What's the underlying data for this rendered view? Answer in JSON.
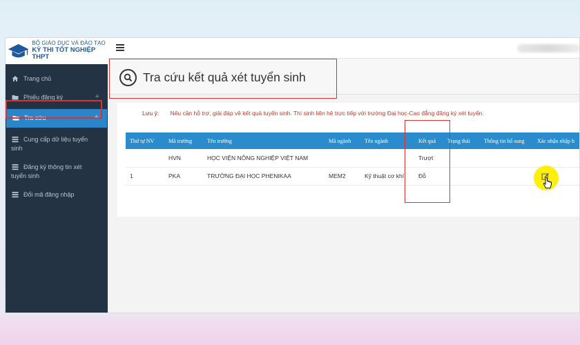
{
  "logo": {
    "line1": "BỘ GIÁO DỤC VÀ ĐÀO TẠO",
    "line2": "KỲ THI TỐT NGHIỆP THPT"
  },
  "sidebar": {
    "items": [
      {
        "label": "Trang chủ",
        "icon": "home-icon"
      },
      {
        "label": "Phiếu đăng ký",
        "icon": "folder-icon",
        "expand": "+"
      },
      {
        "label": "Tra cứu",
        "icon": "folder-icon",
        "expand": "+",
        "active": true
      },
      {
        "label": "Cung cấp dữ liệu tuyển sinh",
        "icon": "list-icon"
      },
      {
        "label": "Đăng ký thông tin xét tuyển sinh",
        "icon": "list-icon"
      },
      {
        "label": "Đổi mã đăng nhập",
        "icon": "list-icon"
      }
    ]
  },
  "page": {
    "title": "Tra cứu kết quả xét tuyển sinh",
    "note_label": "Lưu ý:",
    "note_text": "Nếu cần hỗ trợ, giải đáp về kết quả tuyển sinh. Thí sinh liên hệ trực tiếp với trường Đại học-Cao đẳng đăng ký xét tuyển."
  },
  "table": {
    "headers": [
      "Thứ tự NV",
      "Mã trường",
      "Tên trường",
      "Mã ngành",
      "Tên ngành",
      "Kết quả",
      "Trạng thái",
      "Thông tin bổ sung",
      "Xác nhận nhập h"
    ],
    "rows": [
      [
        "",
        "HVN",
        "HỌC VIỆN NÔNG NGHIỆP VIỆT NAM",
        "",
        "",
        "Trượt",
        "",
        "",
        ""
      ],
      [
        "1",
        "PKA",
        "TRƯỜNG ĐẠI HỌC PHENIKAA",
        "MEM2",
        "Kỹ thuật cơ khí",
        "Đỗ",
        "",
        "",
        ""
      ]
    ]
  },
  "colors": {
    "sidebar_bg": "#243343",
    "accent": "#2b86c9",
    "highlight_box": "#e0312f",
    "note_text": "#c0392b"
  }
}
